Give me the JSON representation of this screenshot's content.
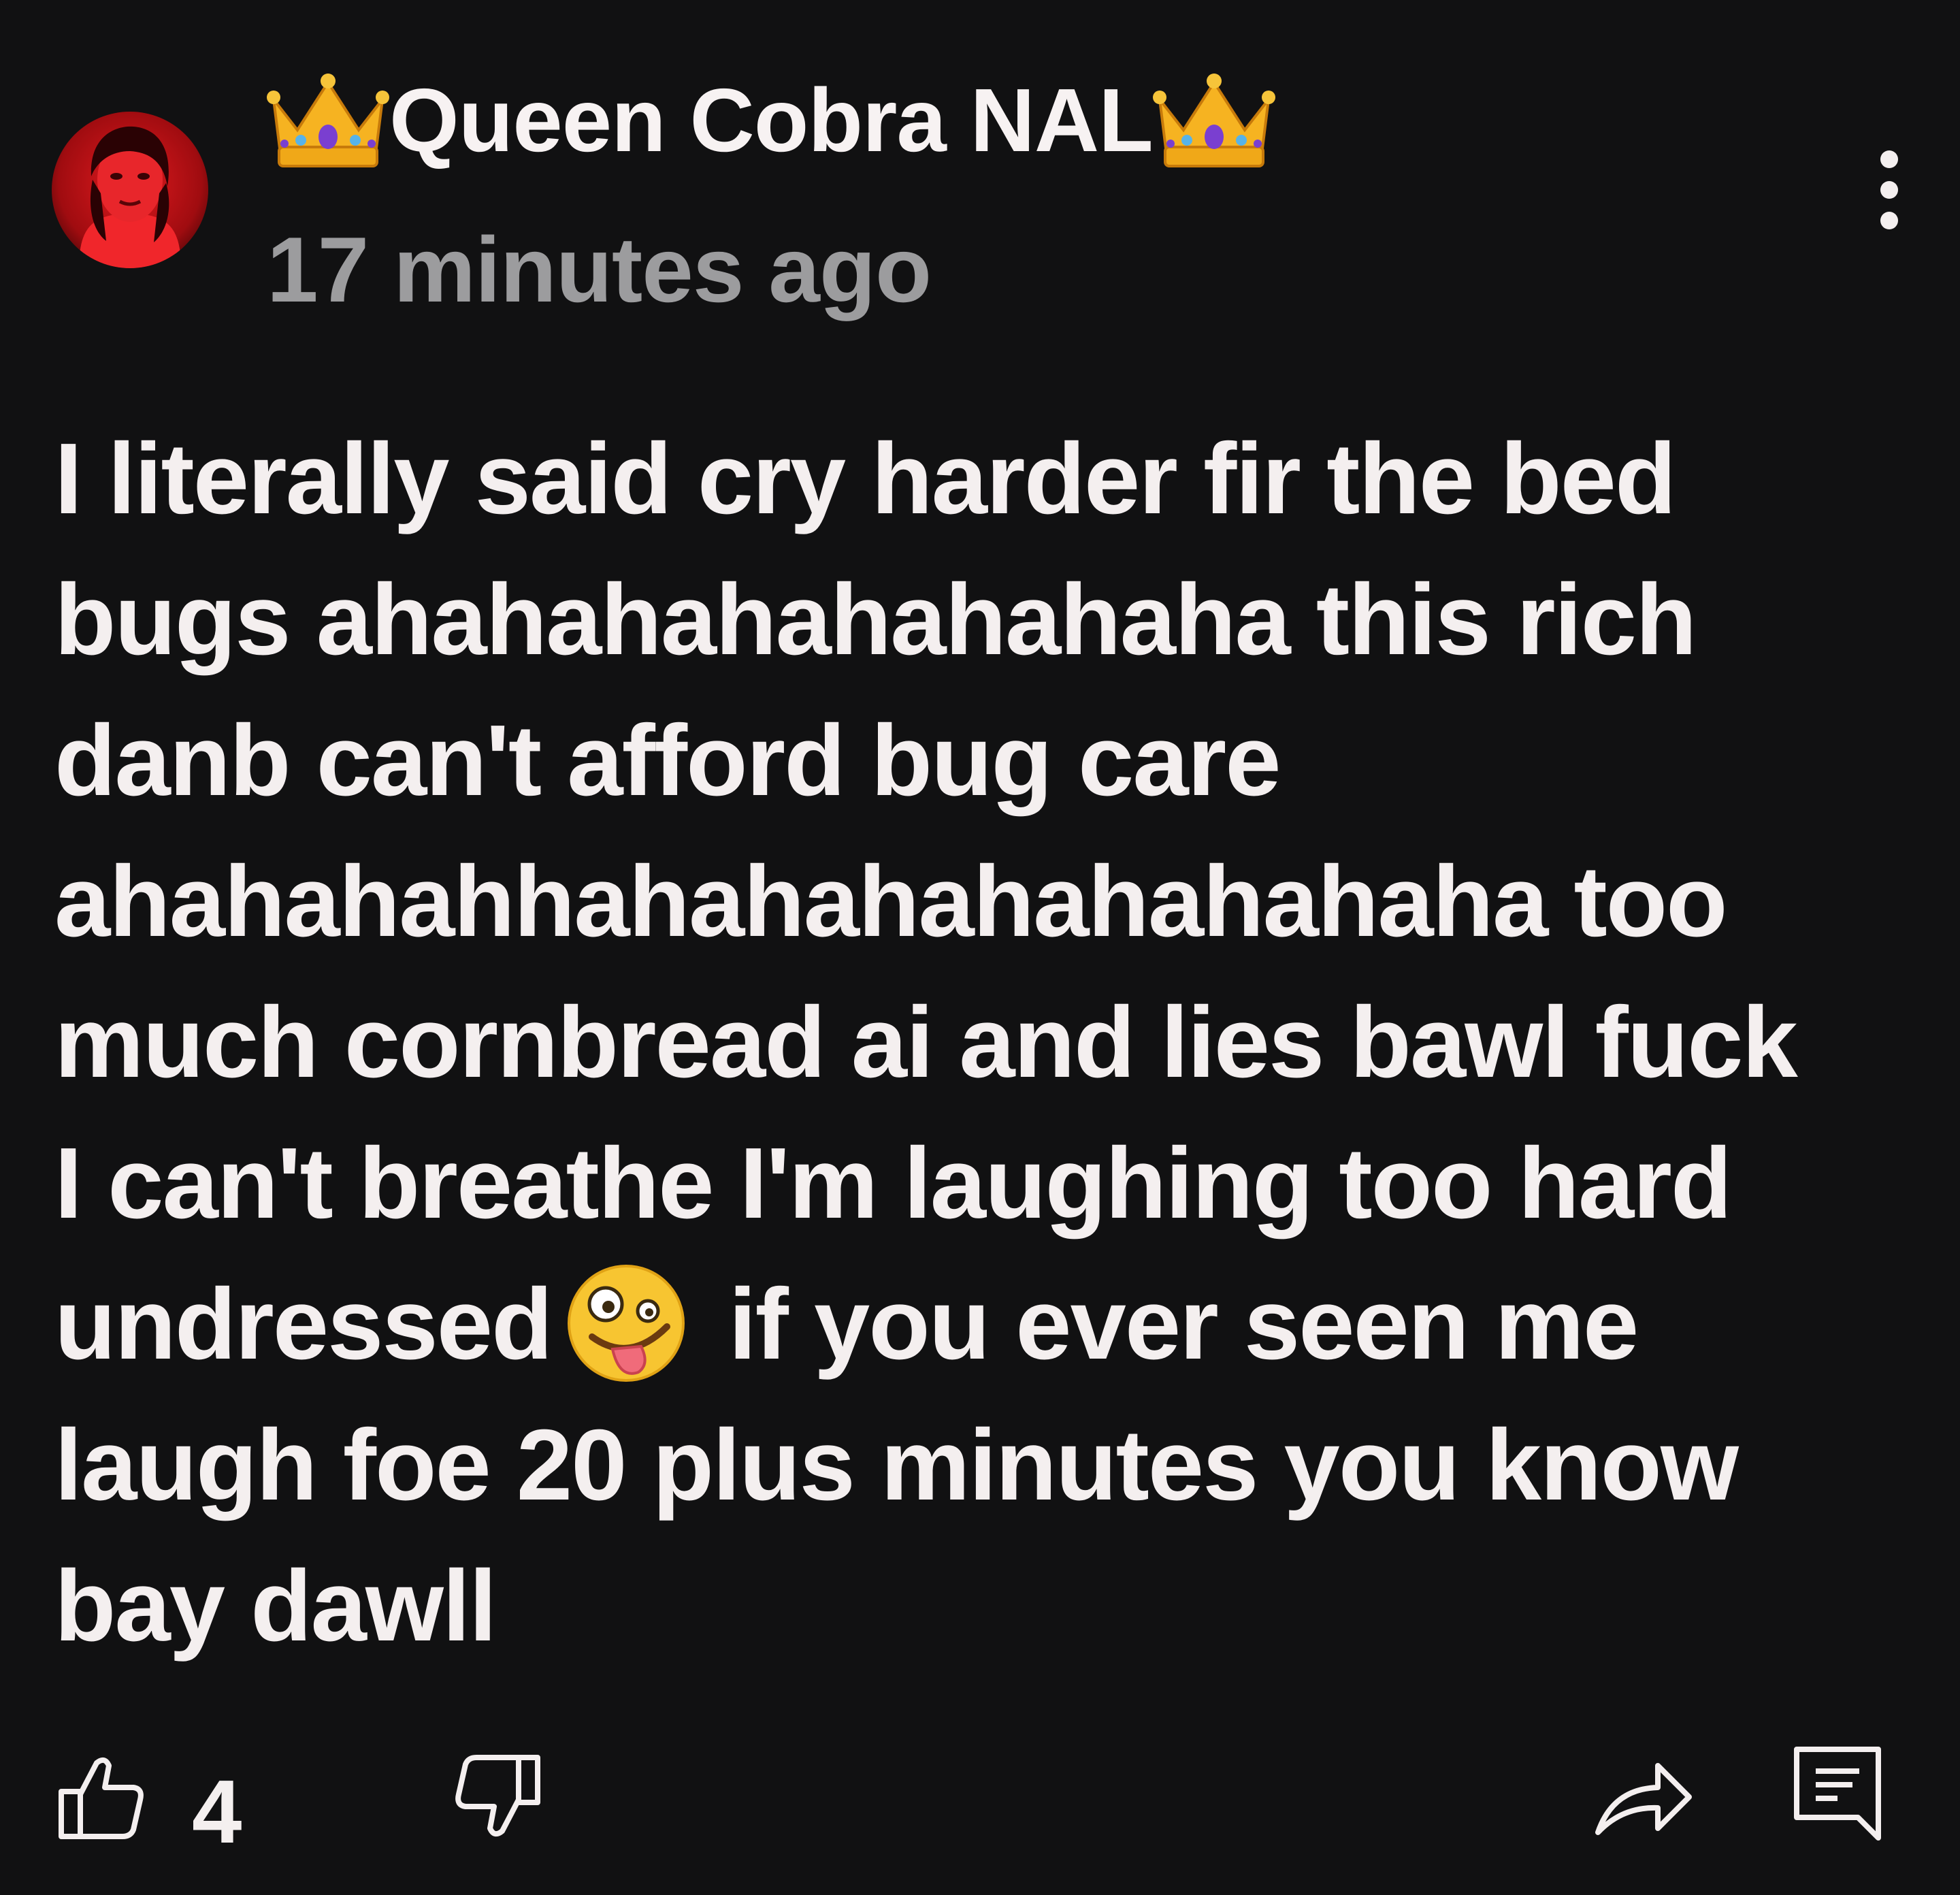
{
  "comment": {
    "author": "Queen Cobra NAL",
    "author_decoration_icon": "crown-emoji",
    "timestamp": "17 minutes ago",
    "avatar_icon": "avatar-red-portrait",
    "body_lines": [
      "I literally said cry harder fir the bed",
      "bugs ahahahahahahahaha this rich",
      "danb can't afford bug care",
      "ahahahahhahahahahahahahaha too",
      "much cornbread ai and lies bawl fuck",
      "I can't breathe I'm laughing too hard"
    ],
    "body_line7_before": "undressed",
    "body_line7_emoji_icon": "zany-face-emoji",
    "body_line7_after": "if you ever seen me",
    "body_lines_end": [
      "laugh foe 20 plus minutes you know",
      "bay dawll"
    ]
  },
  "actions": {
    "like_count": "4",
    "like_icon": "thumbs-up-icon",
    "dislike_icon": "thumbs-down-icon",
    "share_icon": "share-icon",
    "reply_icon": "reply-icon",
    "more_icon": "more-vertical-icon"
  },
  "colors": {
    "background": "#111112",
    "text_primary": "#f4efef",
    "text_secondary": "#9c9c9e",
    "avatar_red": "#d0141b"
  }
}
